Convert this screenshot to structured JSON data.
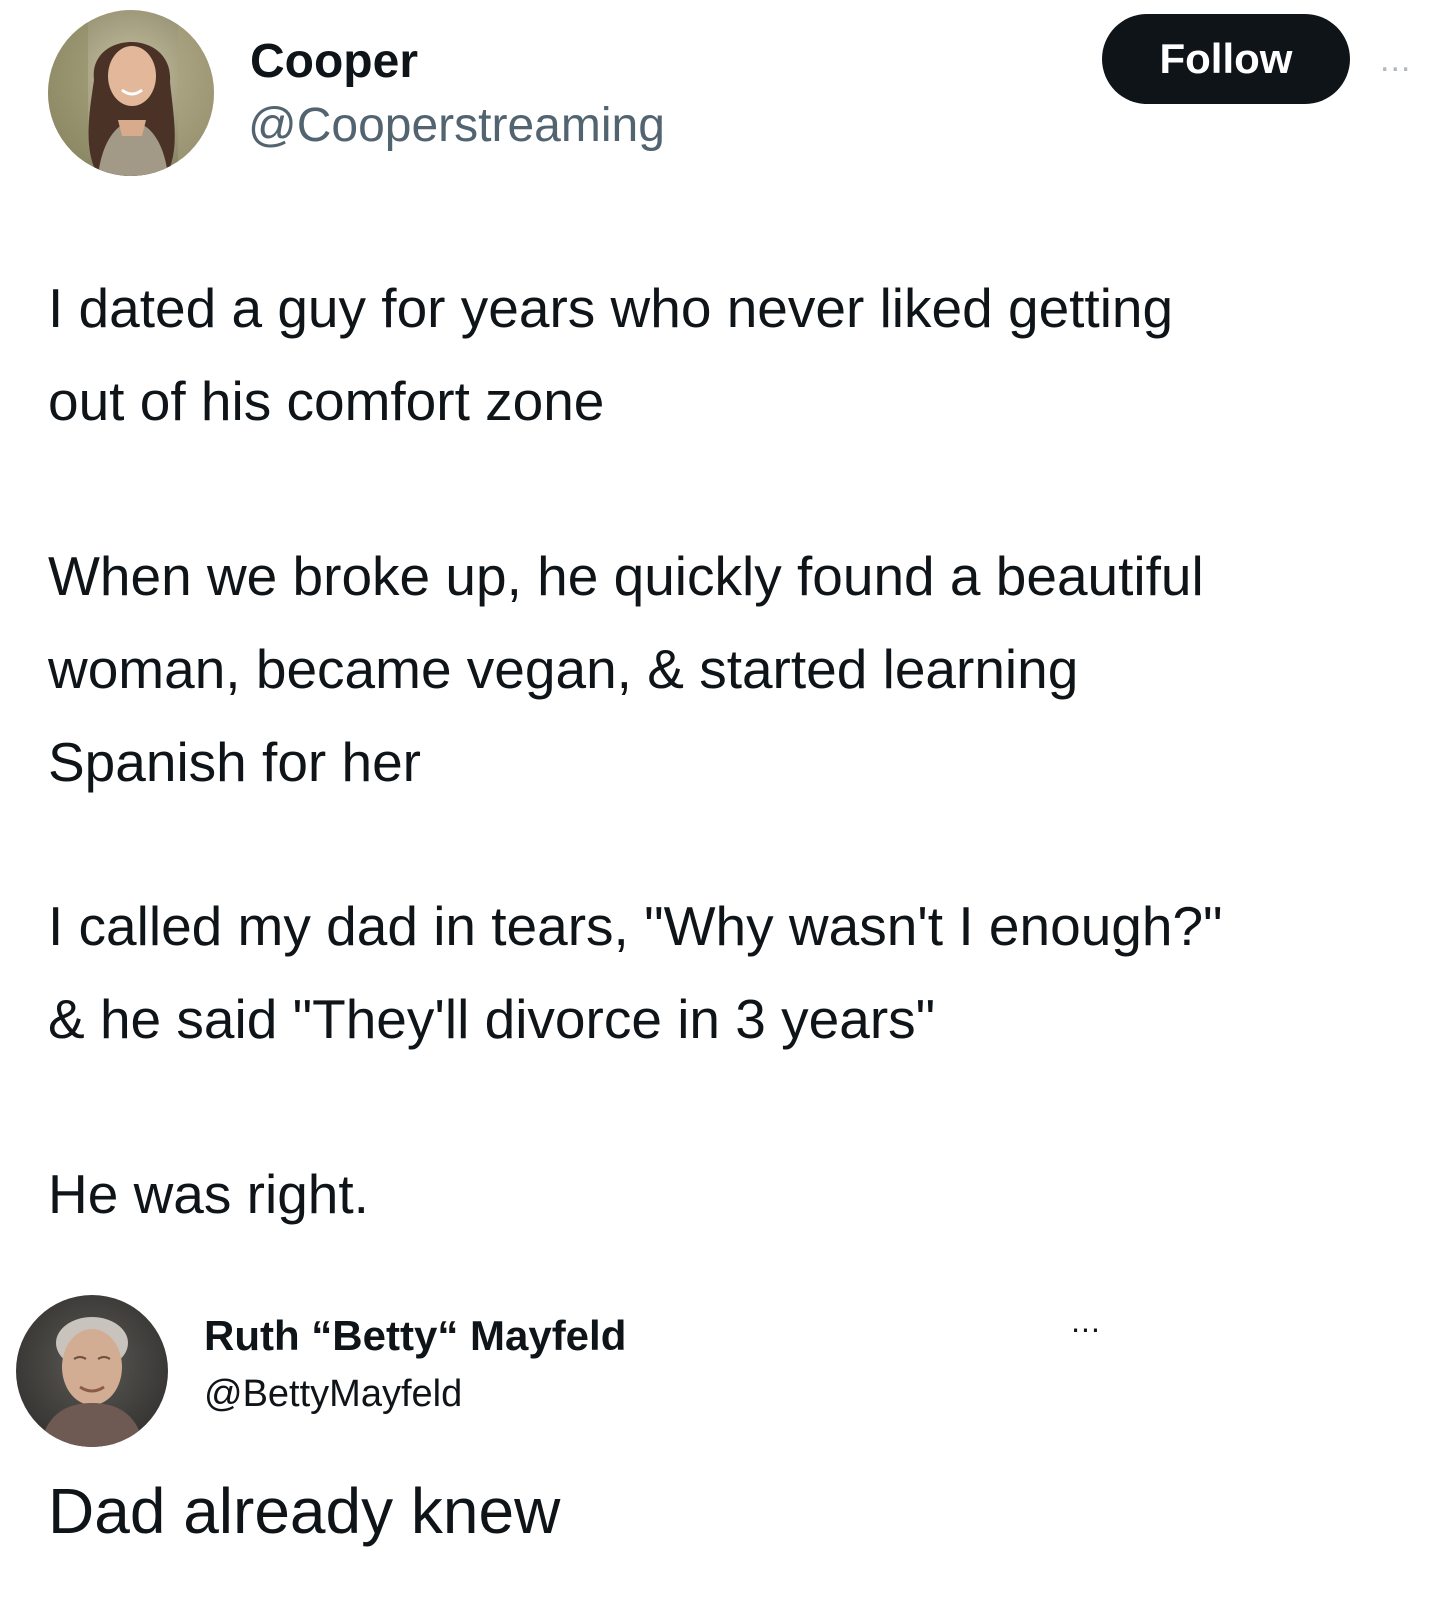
{
  "post": {
    "author": {
      "display_name": "Cooper",
      "handle": "@Cooperstreaming",
      "avatar_icon": "user-avatar-photo"
    },
    "follow_label": "Follow",
    "more_label": "...",
    "paragraphs": [
      "I dated a guy for years who never liked getting\nout of his comfort zone",
      "When we broke up, he quickly found a beautiful\nwoman, became vegan, & started learning\nSpanish for her",
      "I called my dad in tears, \"Why wasn't I enough?\"\n& he said \"They'll divorce in 3 years\"",
      "He was right."
    ]
  },
  "reply": {
    "author": {
      "display_name": "Ruth “Betty“ Mayfeld",
      "handle": "@BettyMayfeld",
      "avatar_icon": "user-avatar-photo"
    },
    "more_label": "...",
    "text": "Dad already knew"
  },
  "colors": {
    "text_primary": "#0f1419",
    "text_secondary": "#536471",
    "follow_bg": "#0f1419",
    "follow_text": "#ffffff"
  }
}
